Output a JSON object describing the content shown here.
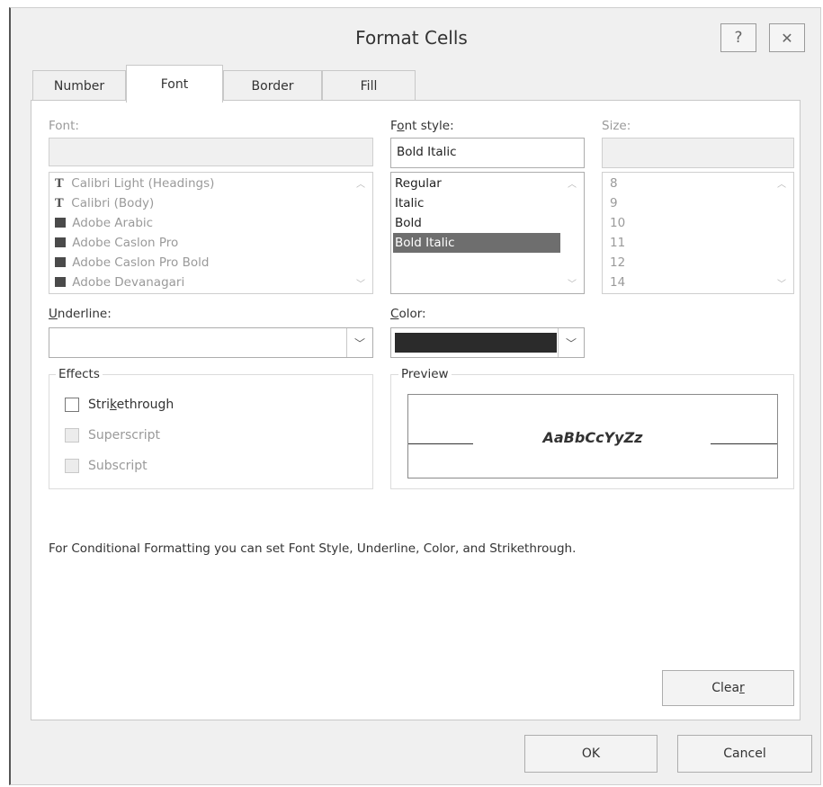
{
  "window": {
    "title": "Format Cells",
    "help_glyph": "?",
    "close_glyph": "✕"
  },
  "tabs": [
    {
      "label": "Number",
      "active": false
    },
    {
      "label": "Font",
      "active": true
    },
    {
      "label": "Border",
      "active": false
    },
    {
      "label": "Fill",
      "active": false
    }
  ],
  "font": {
    "label": "Font:",
    "value": "",
    "items": [
      {
        "name": "Calibri Light (Headings)",
        "icon": "truetype-icon"
      },
      {
        "name": "Calibri (Body)",
        "icon": "truetype-icon"
      },
      {
        "name": "Adobe Arabic",
        "icon": "printer-font-icon"
      },
      {
        "name": "Adobe Caslon Pro",
        "icon": "printer-font-icon"
      },
      {
        "name": "Adobe Caslon Pro Bold",
        "icon": "printer-font-icon"
      },
      {
        "name": "Adobe Devanagari",
        "icon": "printer-font-icon"
      }
    ]
  },
  "font_style": {
    "label_pre": "F",
    "label_acc": "o",
    "label_post": "nt style:",
    "value": "Bold Italic",
    "items": [
      "Regular",
      "Italic",
      "Bold",
      "Bold Italic"
    ],
    "selected": "Bold Italic"
  },
  "size": {
    "label": "Size:",
    "value": "",
    "items": [
      "8",
      "9",
      "10",
      "11",
      "12",
      "14"
    ]
  },
  "underline": {
    "label_acc": "U",
    "label_post": "nderline:",
    "value": ""
  },
  "color": {
    "label_acc": "C",
    "label_post": "olor:",
    "swatch": "#2b2b2b"
  },
  "effects": {
    "title": "Effects",
    "strikethrough": {
      "pre": "Stri",
      "acc": "k",
      "post": "ethrough",
      "checked": false
    },
    "superscript": {
      "label": "Superscript",
      "checked": false
    },
    "subscript": {
      "label": "Subscript",
      "checked": false
    }
  },
  "preview": {
    "title": "Preview",
    "sample": "AaBbCcYyZz"
  },
  "note": "For Conditional Formatting you can set Font Style, Underline, Color, and Strikethrough.",
  "buttons": {
    "clear_pre": "Clea",
    "clear_acc": "r",
    "ok": "OK",
    "cancel": "Cancel"
  },
  "colors": {
    "selection": "#6e6e6e",
    "disabled_text": "#9a9a9a"
  }
}
